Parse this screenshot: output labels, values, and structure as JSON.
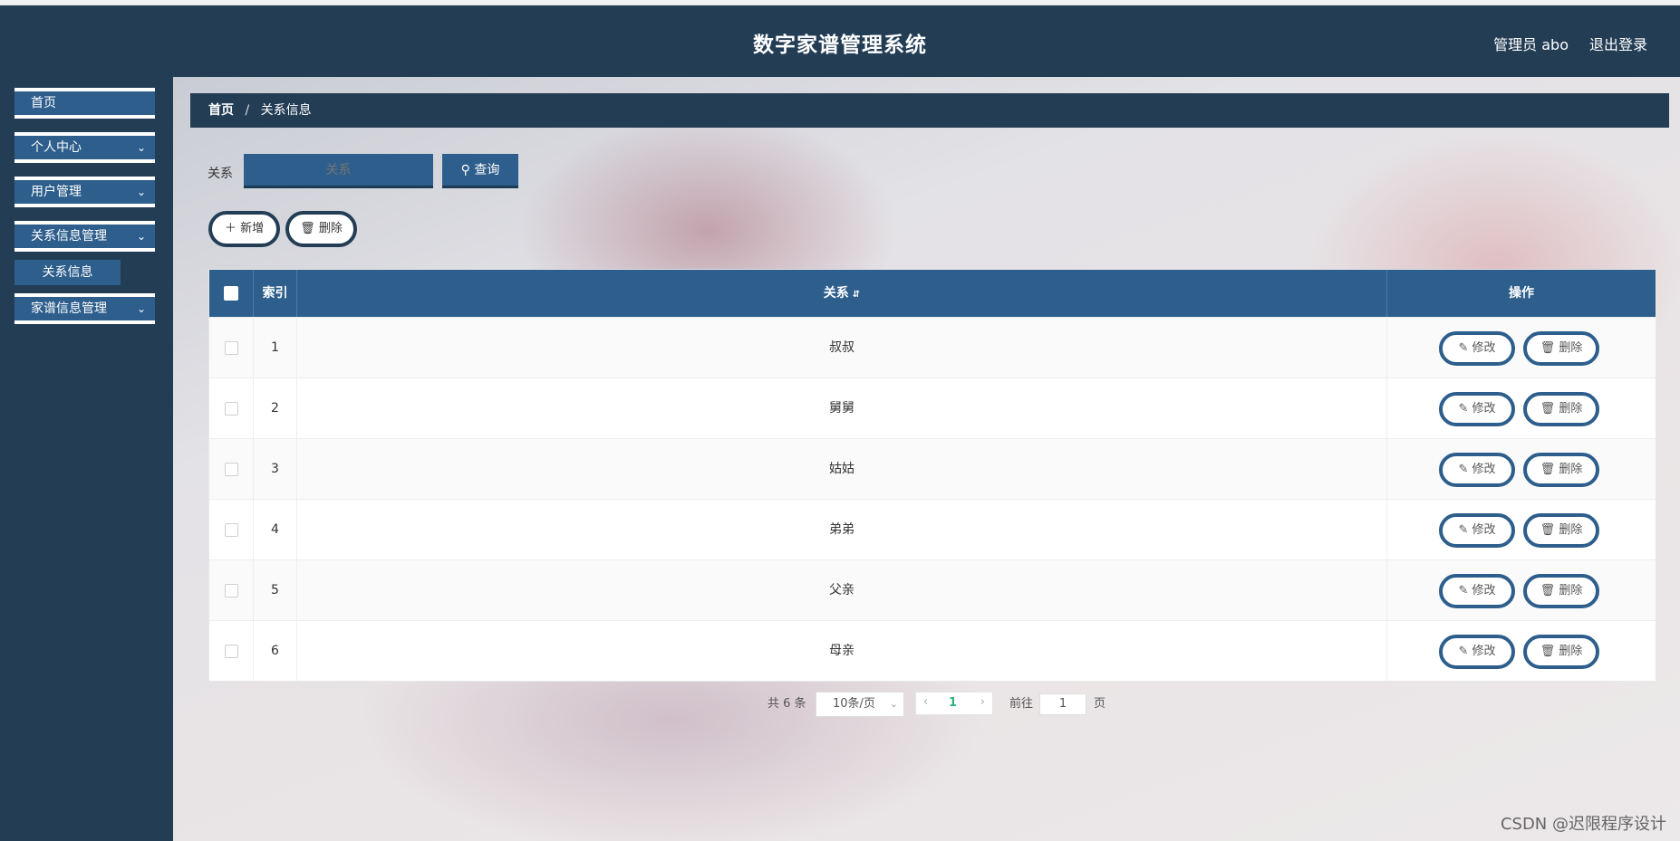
{
  "app": {
    "title": "数字家谱管理系统",
    "admin": "管理员 abo",
    "logout": "退出登录"
  },
  "sidebar": {
    "items": [
      {
        "label": "首页"
      },
      {
        "label": "个人中心"
      },
      {
        "label": "用户管理"
      },
      {
        "label": "关系信息管理"
      },
      {
        "label": "家谱信息管理"
      }
    ],
    "submenu": {
      "label": "关系信息"
    }
  },
  "breadcrumb": {
    "home": "首页",
    "sep": "/",
    "current": "关系信息"
  },
  "search": {
    "label": "关系",
    "placeholder": "关系",
    "button": "查询"
  },
  "actions": {
    "add": "新增",
    "delete": "删除"
  },
  "table": {
    "headers": {
      "index": "索引",
      "relation": "关系",
      "ops": "操作"
    },
    "rows": [
      {
        "index": "1",
        "relation": "叔叔"
      },
      {
        "index": "2",
        "relation": "舅舅"
      },
      {
        "index": "3",
        "relation": "姑姑"
      },
      {
        "index": "4",
        "relation": "弟弟"
      },
      {
        "index": "5",
        "relation": "父亲"
      },
      {
        "index": "6",
        "relation": "母亲"
      }
    ],
    "edit_label": "修改",
    "delete_label": "删除"
  },
  "pager": {
    "total": "共 6 条",
    "size": "10条/页",
    "current": "1",
    "goto": "前往",
    "goto_value": "1",
    "page": "页"
  },
  "watermark": "CSDN @迟限程序设计"
}
